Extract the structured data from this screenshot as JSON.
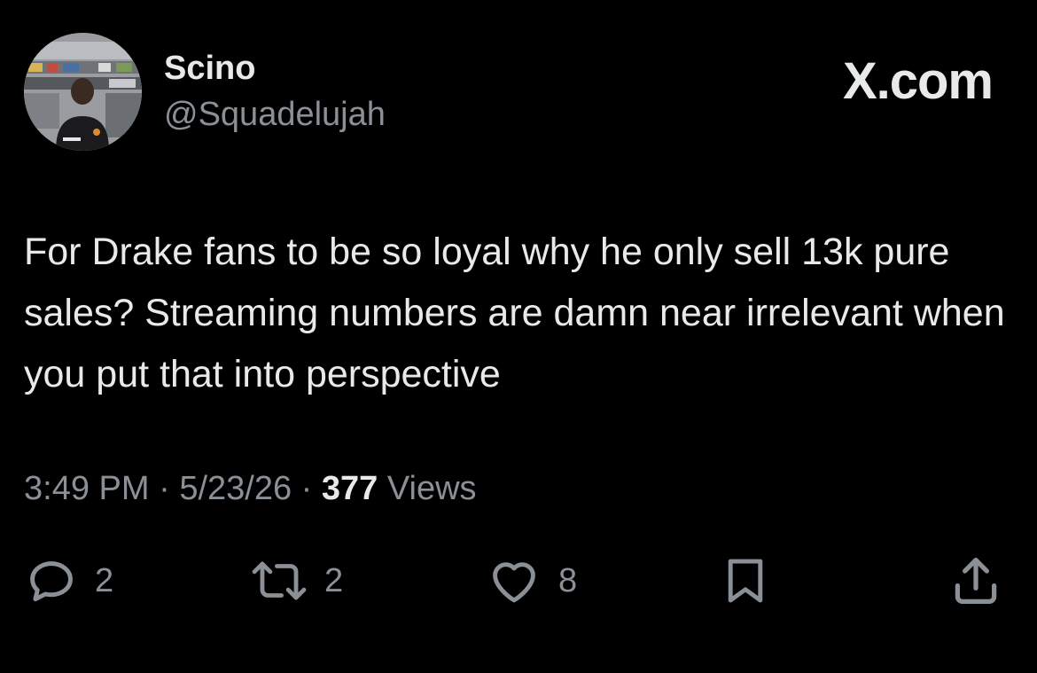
{
  "author": {
    "display_name": "Scino",
    "handle": "@Squadelujah",
    "avatar_icon": "profile-photo"
  },
  "brand": {
    "label": "X.com"
  },
  "tweet": {
    "text": "For Drake fans to be so loyal why he only sell 13k pure sales? Streaming numbers are damn near irrelevant when you put that into perspective",
    "time": "3:49 PM",
    "date": "5/23/26",
    "separator": "·",
    "views_count": "377",
    "views_label": "Views"
  },
  "actions": {
    "reply": {
      "icon": "reply-icon",
      "count": "2"
    },
    "repost": {
      "icon": "repost-icon",
      "count": "2"
    },
    "like": {
      "icon": "heart-icon",
      "count": "8"
    },
    "bookmark": {
      "icon": "bookmark-icon"
    },
    "share": {
      "icon": "share-icon"
    }
  },
  "colors": {
    "background": "#000000",
    "primary_text": "#e7e9ea",
    "secondary_text": "#8b9096"
  }
}
